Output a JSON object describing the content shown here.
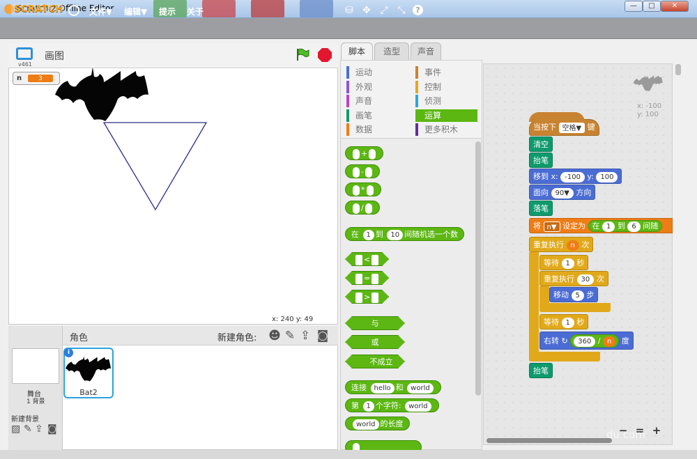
{
  "window": {
    "title": "Scratch 2 Offline Editor",
    "minimize": "—",
    "maximize": "□",
    "close": "✕"
  },
  "menubar": {
    "logo": "SCRATCH",
    "items": [
      "文件▼",
      "编辑▼",
      "提示",
      "关于"
    ],
    "tools": [
      "⛁",
      "✥",
      "⤢",
      "⤡",
      "?"
    ]
  },
  "stage": {
    "name": "画图",
    "version": "v461",
    "variable": {
      "name": "n",
      "value": "3"
    },
    "coords": "x: 240  y: 49"
  },
  "sprites": {
    "title": "角色",
    "new_sprite_label": "新建角色:",
    "stage_label": "舞台",
    "backdrop_count": "1 背景",
    "new_backdrop_label": "新建背景",
    "sprite_name": "Bat2",
    "info_icon": "i"
  },
  "tabs": [
    "脚本",
    "造型",
    "声音"
  ],
  "categories": {
    "left": [
      {
        "label": "运动",
        "color": "#4a6cd4"
      },
      {
        "label": "外观",
        "color": "#8a55d7"
      },
      {
        "label": "声音",
        "color": "#bb42c3"
      },
      {
        "label": "画笔",
        "color": "#0e9a6c"
      },
      {
        "label": "数据",
        "color": "#ee7d16"
      }
    ],
    "right": [
      {
        "label": "事件",
        "color": "#c88330"
      },
      {
        "label": "控制",
        "color": "#e1a91a"
      },
      {
        "label": "侦测",
        "color": "#2ca5e2"
      },
      {
        "label": "运算",
        "color": "#5cb712"
      },
      {
        "label": "更多积木",
        "color": "#632d99"
      }
    ],
    "selected": "运算"
  },
  "palette": {
    "ops": [
      "+",
      "-",
      "*",
      "/"
    ],
    "random": {
      "pre": "在",
      "a": "1",
      "mid": "到",
      "b": "10",
      "post": "间随机选一个数"
    },
    "compare": [
      "<",
      "=",
      ">"
    ],
    "logic": [
      "与",
      "或",
      "不成立"
    ],
    "join": {
      "pre": "连接",
      "a": "hello",
      "mid": "和",
      "b": "world"
    },
    "letter": {
      "pre": "第",
      "a": "1",
      "mid": "个字符:",
      "b": "world"
    },
    "length": {
      "a": "world",
      "post": "的长度"
    }
  },
  "script_sprite": {
    "x": "x: -100",
    "y": "y: 100"
  },
  "script": {
    "hat": {
      "pre": "当按下",
      "key": "空格▼",
      "post": "键"
    },
    "clear": "清空",
    "penup1": "抬笔",
    "goto": {
      "pre": "移到 x:",
      "x": "-100",
      "mid": "y:",
      "y": "100"
    },
    "point": {
      "pre": "面向",
      "dir": "90▼",
      "post": "方向"
    },
    "pendown": "落笔",
    "setvar": {
      "pre": "将",
      "var": "n▼",
      "mid": "设定为",
      "rpre": "在",
      "a": "1",
      "rmid": "到",
      "b": "6",
      "rpost": "间随"
    },
    "repeat1": {
      "pre": "重复执行",
      "n": "n",
      "post": "次"
    },
    "wait1": {
      "pre": "等待",
      "v": "1",
      "post": "秒"
    },
    "repeat2": {
      "pre": "重复执行",
      "v": "30",
      "post": "次"
    },
    "move": {
      "pre": "移动",
      "v": "5",
      "post": "步"
    },
    "wait2": {
      "pre": "等待",
      "v": "1",
      "post": "秒"
    },
    "turn": {
      "pre": "右转 ↻",
      "a": "360",
      "op": "/",
      "b": "n",
      "post": "度"
    },
    "penup2": "抬笔"
  },
  "zoom": [
    "−",
    "=",
    "+"
  ],
  "watermark": "du.com"
}
